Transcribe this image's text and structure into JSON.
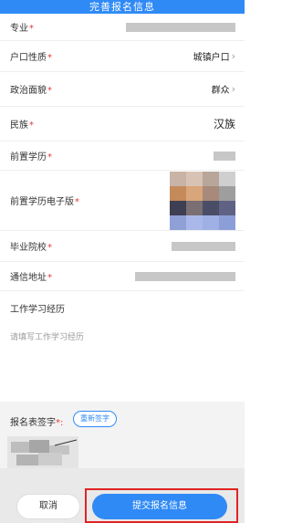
{
  "header": {
    "title": "完善报名信息"
  },
  "fields": {
    "major": {
      "label": "专业",
      "required": "*"
    },
    "hukou": {
      "label": "户口性质",
      "required": "*",
      "value": "城镇户口"
    },
    "political": {
      "label": "政治面貌",
      "required": "*",
      "value": "群众"
    },
    "ethnicity": {
      "label": "民族",
      "required": "*",
      "value": "汉族"
    },
    "prior_edu": {
      "label": "前置学历",
      "required": "*"
    },
    "prior_edu_e": {
      "label": "前置学历电子版",
      "required": "*"
    },
    "school": {
      "label": "毕业院校",
      "required": "*"
    },
    "address": {
      "label": "通信地址",
      "required": "*"
    }
  },
  "work": {
    "title": "工作学习经历",
    "placeholder": "请填写工作学习经历"
  },
  "signature": {
    "label": "报名表签字",
    "required": "*:",
    "resign": "重新签字"
  },
  "actions": {
    "cancel": "取消",
    "submit": "提交报名信息"
  },
  "colors": {
    "accent": "#2f8af5",
    "required": "#e03a3a",
    "highlight": "#e02424"
  }
}
